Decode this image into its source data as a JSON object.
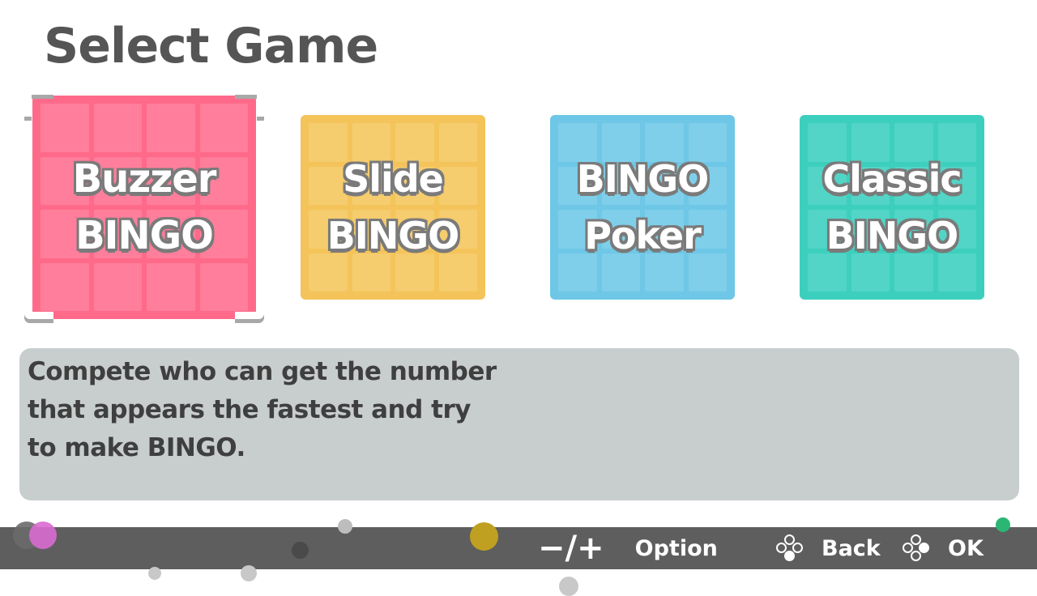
{
  "title": "Select Game",
  "games": [
    {
      "line1": "Buzzer",
      "line2": "BINGO",
      "color": "#ff6a8a",
      "cell_color": "#ff7e9b",
      "selected": true
    },
    {
      "line1": "Slide",
      "line2": "BINGO",
      "color": "#f4c45a",
      "cell_color": "#f5cc6e",
      "selected": false
    },
    {
      "line1": "BINGO",
      "line2": "Poker",
      "color": "#6ec7e6",
      "cell_color": "#7fcfea",
      "selected": false
    },
    {
      "line1": "Classic",
      "line2": "BINGO",
      "color": "#3dcfbd",
      "cell_color": "#52d5c6",
      "selected": false
    }
  ],
  "description": {
    "line1": "Compete who can get the number",
    "line2": "that appears the fastest and try",
    "line3": "to make BINGO."
  },
  "footer": {
    "minus_plus": "−/+",
    "option_label": "Option",
    "back_label": "Back",
    "ok_label": "OK"
  },
  "colors": {
    "footer_bar": "#5e5e5e",
    "description_panel": "#c8cdce",
    "title_text": "#555555"
  }
}
